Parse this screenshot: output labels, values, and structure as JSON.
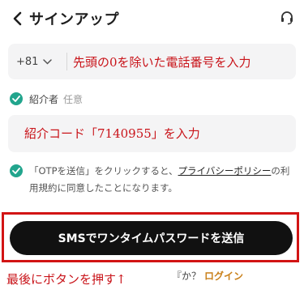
{
  "header": {
    "back_icon": "chevron-left-icon",
    "title": "サインアップ",
    "support_icon": "headset-icon"
  },
  "phone": {
    "country_code": "+81",
    "country_chevron_icon": "chevron-down-icon",
    "placeholder": "先頭の0を除いた電話番号を入力"
  },
  "referral": {
    "label": "紹介者",
    "optional": "任意",
    "placeholder": "紹介コード「7140955」を入力"
  },
  "consent": {
    "prefix": "「OTPを送信」をクリックすると、",
    "link": "プライバシーポリシー",
    "suffix": "の利用規約に同意したことになります。"
  },
  "submit": {
    "label": "SMSでワンタイムパスワードを送信"
  },
  "annotation": {
    "note": "最後にボタンを押す↑"
  },
  "login": {
    "prompt": "『か？",
    "link": "ログイン"
  },
  "colors": {
    "accent": "#22a58d",
    "button": "#111111",
    "annotation": "#d21414",
    "login_link": "#c9801a"
  }
}
